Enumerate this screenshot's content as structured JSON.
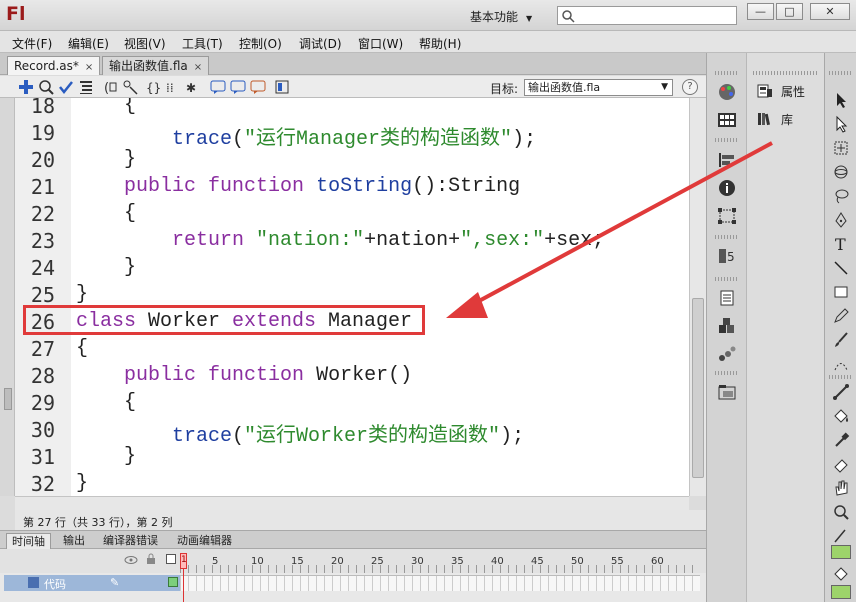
{
  "app": {
    "logo": "Fl",
    "workspace": "基本功能",
    "search_placeholder": "",
    "window_buttons": [
      "—",
      "□",
      "✕"
    ]
  },
  "menu": [
    "文件(F)",
    "编辑(E)",
    "视图(V)",
    "工具(T)",
    "控制(O)",
    "调试(D)",
    "窗口(W)",
    "帮助(H)"
  ],
  "doc_tabs": [
    {
      "label": "Record.as*",
      "close": "×"
    },
    {
      "label": "输出函数值.fla",
      "close": "×"
    }
  ],
  "toolbar": {
    "target_label": "目标:",
    "target_value": "输出函数值.fla",
    "help": "?"
  },
  "editor": {
    "lines": [
      {
        "num": "18",
        "text": "    {"
      },
      {
        "num": "19",
        "text": "        trace(\"运行Manager类的构造函数\");"
      },
      {
        "num": "20",
        "text": "    }"
      },
      {
        "num": "21",
        "text": "    public function toString():String"
      },
      {
        "num": "22",
        "text": "    {"
      },
      {
        "num": "23",
        "text": "        return \"nation:\"+nation+\",sex:\"+sex;"
      },
      {
        "num": "24",
        "text": "    }"
      },
      {
        "num": "25",
        "text": "}"
      },
      {
        "num": "26",
        "text": "class Worker extends Manager"
      },
      {
        "num": "27",
        "text": "{"
      },
      {
        "num": "28",
        "text": "    public function Worker()"
      },
      {
        "num": "29",
        "text": "    {"
      },
      {
        "num": "30",
        "text": "        trace(\"运行Worker类的构造函数\");"
      },
      {
        "num": "31",
        "text": "    }"
      },
      {
        "num": "32",
        "text": "}"
      }
    ]
  },
  "status": "第 27 行（共 33 行），第 2 列",
  "timeline": {
    "tabs": [
      "时间轴",
      "输出",
      "编译器错误",
      "动画编辑器"
    ],
    "ruler": [
      "5",
      "10",
      "15",
      "20",
      "25",
      "30",
      "35",
      "40",
      "45",
      "50",
      "55",
      "60"
    ],
    "layer_name": "代码",
    "frame1": "1"
  },
  "panels": {
    "properties": "属性",
    "library": "库"
  },
  "annotation": {
    "highlight_color": "#e03a3a"
  }
}
